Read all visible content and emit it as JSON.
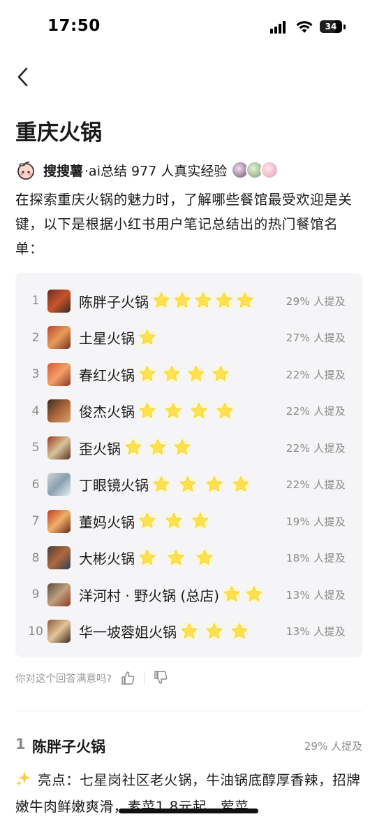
{
  "status": {
    "time": "17:50",
    "battery": "34"
  },
  "page": {
    "title": "重庆火锅"
  },
  "source": {
    "name": "搜搜薯",
    "summary": "·ai总结 977 人真实经验"
  },
  "intro": "在探索重庆火锅的魅力时，了解哪些餐馆最受欢迎是关键，以下是根据小红书用户笔记总结出的热门餐馆名单：",
  "ranking": [
    {
      "num": "1",
      "name": "陈胖子火锅",
      "stars": 5,
      "pct": "29% 人提及"
    },
    {
      "num": "2",
      "name": "土星火锅",
      "stars": 1,
      "pct": "27% 人提及"
    },
    {
      "num": "3",
      "name": "春红火锅",
      "stars": 4,
      "pct": "22% 人提及"
    },
    {
      "num": "4",
      "name": "俊杰火锅",
      "stars": 4,
      "pct": "22% 人提及"
    },
    {
      "num": "5",
      "name": "歪火锅",
      "stars": 3,
      "pct": "22% 人提及"
    },
    {
      "num": "6",
      "name": "丁眼镜火锅",
      "stars": 4,
      "pct": "22% 人提及"
    },
    {
      "num": "7",
      "name": "董妈火锅",
      "stars": 3,
      "pct": "19% 人提及"
    },
    {
      "num": "8",
      "name": "大彬火锅",
      "stars": 3,
      "pct": "18% 人提及"
    },
    {
      "num": "9",
      "name": "洋河村 · 野火锅 (总店)",
      "stars": 2,
      "pct": "13% 人提及"
    },
    {
      "num": "10",
      "name": "华一坡蓉姐火锅",
      "stars": 3,
      "pct": "13% 人提及"
    }
  ],
  "feedback": {
    "question": "你对这个回答满意吗?"
  },
  "detail": {
    "num": "1",
    "name": "陈胖子火锅",
    "pct": "29% 人提及",
    "body": "亮点：七星岗社区老火锅，牛油锅底醇厚香辣，招牌嫩牛肉鲜嫩爽滑，素菜1.8元起，荤菜"
  },
  "colors": {
    "star": "#ffe14d",
    "card_bg": "#f5f5f7",
    "muted": "#8a8a8a"
  },
  "icons": [
    "back-icon",
    "peach-icon",
    "star-icon",
    "thumbs-up-icon",
    "thumbs-down-icon",
    "sparkle-icon"
  ]
}
